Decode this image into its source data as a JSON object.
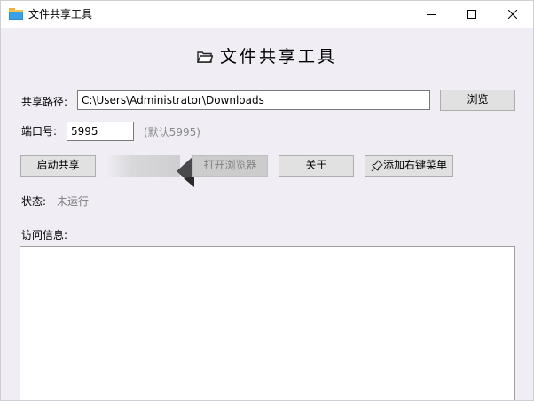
{
  "window": {
    "title": "文件共享工具"
  },
  "header": {
    "title": "文件共享工具",
    "icon": "folder-icon"
  },
  "share_path": {
    "label": "共享路径:",
    "value": "C:\\Users\\Administrator\\Downloads",
    "browse_label": "浏览"
  },
  "port": {
    "label": "端口号:",
    "value": "5995",
    "hint": "(默认5995)"
  },
  "actions": {
    "start_label": "启动共享",
    "open_browser_label": "打开浏览器",
    "about_label": "关于",
    "context_menu_label": "添加右键菜单",
    "context_menu_icon": "pin-icon"
  },
  "status": {
    "label": "状态:",
    "value": "未运行"
  },
  "access": {
    "label": "访问信息:",
    "content": ""
  },
  "colors": {
    "window_bg": "#f0eef4",
    "button_bg": "#e1e1e1",
    "hint_text": "#8a8a8a"
  }
}
